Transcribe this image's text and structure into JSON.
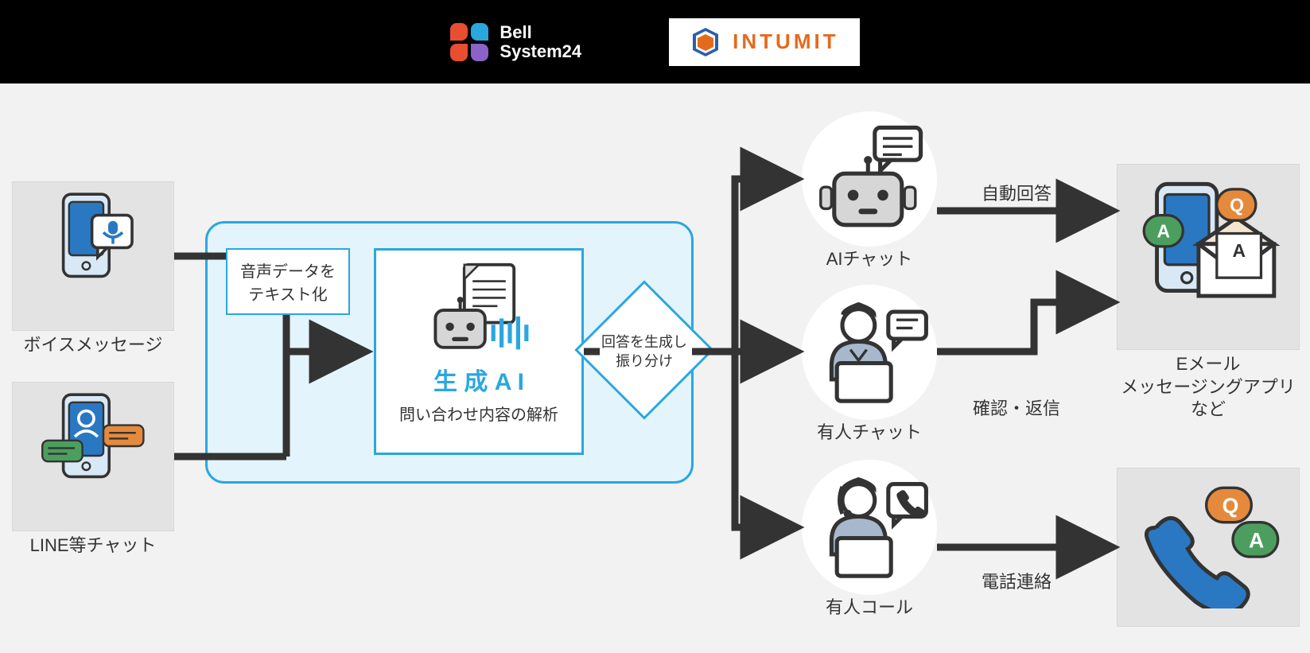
{
  "header": {
    "bellsystem_name": "Bell\nSystem24",
    "intumit_name": "INTUMIT"
  },
  "inputs": {
    "voice_label": "ボイスメッセージ",
    "line_label": "LINE等チャット"
  },
  "processing": {
    "voice_to_text": "音声データを\nテキスト化",
    "gen_ai_title": "生 成 A I",
    "gen_ai_sub": "問い合わせ内容の解析",
    "router": "回答を生成し\n振り分け"
  },
  "outputs": {
    "ai_chat": "AIチャット",
    "human_chat": "有人チャット",
    "human_call": "有人コール",
    "auto_reply": "自動回答",
    "confirm_reply": "確認・返信",
    "phone_contact": "電話連絡",
    "email_etc": "Eメール\nメッセージングアプリ\nなど"
  }
}
